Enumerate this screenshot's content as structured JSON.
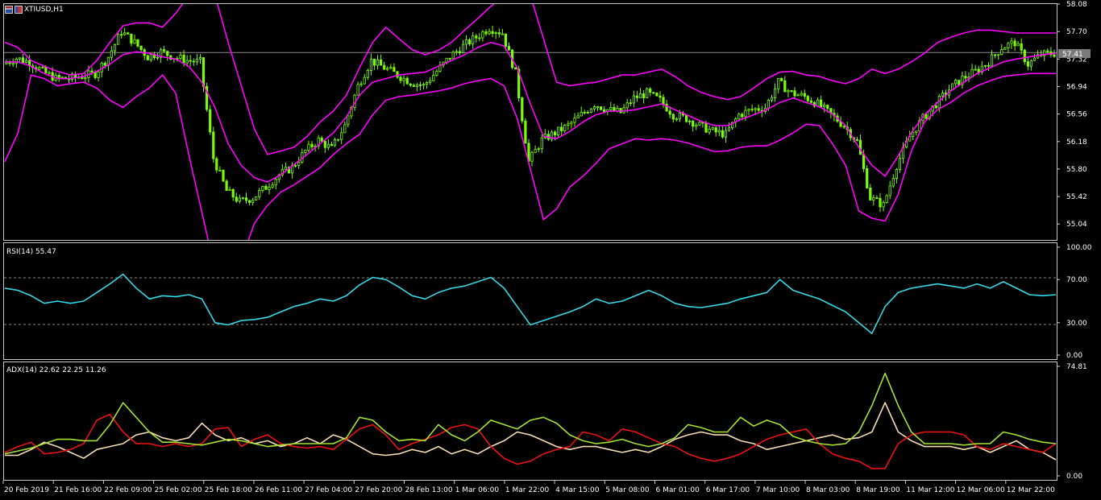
{
  "symbol": {
    "title": "XTIUSD,H1",
    "flag_icon_a": "flag-icon",
    "flag_icon_b": "flag-icon"
  },
  "price_tag": "57.41",
  "colors": {
    "candle": "#7CFC00",
    "bands": "#FF00FF",
    "rsi": "#34D8E6",
    "adx": "#A6E22E",
    "plus_di": "#EE1111",
    "minus_di": "#F5DEB3",
    "frame": "#C8C8C8",
    "grid": "#888888"
  },
  "chart_data": [
    {
      "type": "line",
      "name": "price",
      "title": "XTIUSD,H1",
      "ylim": [
        54.82,
        58.08
      ],
      "y_ticks": [
        "58.08",
        "57.70",
        "57.32",
        "56.94",
        "56.56",
        "56.18",
        "55.80",
        "55.42",
        "55.04"
      ],
      "current_price": 57.41,
      "series": [
        {
          "name": "close",
          "values": [
            57.25,
            57.33,
            57.28,
            57.15,
            57.05,
            57.05,
            57.08,
            57.12,
            57.35,
            57.7,
            57.55,
            57.35,
            57.42,
            57.35,
            57.3,
            57.28,
            55.95,
            55.5,
            55.35,
            55.4,
            55.55,
            55.72,
            55.82,
            56.05,
            56.2,
            56.08,
            56.4,
            56.95,
            57.3,
            57.2,
            57.1,
            57.0,
            56.95,
            57.15,
            57.35,
            57.5,
            57.62,
            57.75,
            57.68,
            57.12,
            55.9,
            56.2,
            56.3,
            56.4,
            56.55,
            56.7,
            56.62,
            56.58,
            56.78,
            56.85,
            56.75,
            56.55,
            56.5,
            56.4,
            56.32,
            56.28,
            56.55,
            56.62,
            56.65,
            57.0,
            56.85,
            56.8,
            56.7,
            56.55,
            56.4,
            56.18,
            55.4,
            55.3,
            55.85,
            56.25,
            56.5,
            56.7,
            56.9,
            57.05,
            57.15,
            57.28,
            57.48,
            57.55,
            57.25,
            57.38,
            57.4
          ]
        },
        {
          "name": "upper_band",
          "values": [
            57.55,
            57.48,
            57.3,
            57.22,
            57.15,
            57.1,
            57.12,
            57.3,
            57.55,
            57.78,
            57.82,
            57.82,
            57.76,
            57.95,
            58.2,
            58.2,
            58.2,
            57.55,
            56.95,
            56.35,
            56.0,
            56.05,
            56.1,
            56.25,
            56.45,
            56.6,
            56.82,
            57.2,
            57.55,
            57.76,
            57.6,
            57.45,
            57.38,
            57.44,
            57.55,
            57.72,
            57.88,
            58.05,
            58.2,
            58.2,
            58.2,
            57.6,
            57.0,
            56.95,
            56.98,
            57.0,
            57.05,
            57.1,
            57.1,
            57.14,
            57.18,
            57.08,
            56.95,
            56.86,
            56.8,
            56.76,
            56.8,
            56.92,
            57.05,
            57.14,
            57.15,
            57.1,
            57.08,
            57.02,
            56.98,
            57.05,
            57.18,
            57.12,
            57.18,
            57.28,
            57.4,
            57.55,
            57.62,
            57.68,
            57.72,
            57.72,
            57.7,
            57.68,
            57.68,
            57.68,
            57.68
          ]
        },
        {
          "name": "middle_band",
          "values": [
            57.28,
            57.28,
            57.22,
            57.12,
            57.05,
            57.05,
            57.08,
            57.15,
            57.25,
            57.38,
            57.42,
            57.4,
            57.35,
            57.32,
            57.22,
            57.0,
            56.65,
            56.15,
            55.85,
            55.68,
            55.62,
            55.72,
            55.86,
            56.0,
            56.15,
            56.3,
            56.52,
            56.82,
            57.0,
            57.05,
            57.1,
            57.12,
            57.14,
            57.22,
            57.3,
            57.38,
            57.48,
            57.55,
            57.5,
            57.2,
            56.7,
            56.25,
            56.22,
            56.32,
            56.45,
            56.55,
            56.6,
            56.6,
            56.62,
            56.66,
            56.7,
            56.62,
            56.54,
            56.46,
            56.4,
            56.4,
            56.48,
            56.55,
            56.62,
            56.72,
            56.78,
            56.72,
            56.66,
            56.56,
            56.4,
            56.1,
            55.85,
            55.7,
            55.98,
            56.3,
            56.55,
            56.72,
            56.88,
            57.0,
            57.12,
            57.2,
            57.28,
            57.32,
            57.35,
            57.38,
            57.4
          ]
        },
        {
          "name": "lower_band",
          "values": [
            55.9,
            56.3,
            57.1,
            57.05,
            56.95,
            56.98,
            57.0,
            56.92,
            56.75,
            56.65,
            56.8,
            56.92,
            57.1,
            56.85,
            56.0,
            55.2,
            54.4,
            54.2,
            54.55,
            55.05,
            55.3,
            55.48,
            55.58,
            55.7,
            55.82,
            56.0,
            56.15,
            56.28,
            56.55,
            56.75,
            56.8,
            56.82,
            56.85,
            56.88,
            56.92,
            56.98,
            57.02,
            57.05,
            56.95,
            56.5,
            55.8,
            55.1,
            55.25,
            55.55,
            55.7,
            55.88,
            56.08,
            56.15,
            56.22,
            56.2,
            56.22,
            56.2,
            56.16,
            56.1,
            56.04,
            56.05,
            56.1,
            56.12,
            56.12,
            56.2,
            56.3,
            56.42,
            56.4,
            56.15,
            55.85,
            55.22,
            55.12,
            55.08,
            55.45,
            56.05,
            56.45,
            56.62,
            56.72,
            56.85,
            56.95,
            57.02,
            57.08,
            57.1,
            57.12,
            57.12,
            57.12
          ]
        }
      ]
    },
    {
      "type": "line",
      "name": "rsi",
      "title": "RSI(14) 55.47",
      "ylim": [
        0,
        100
      ],
      "y_ticks": [
        "100.00",
        "70.00",
        "30.00",
        "0.00"
      ],
      "levels": [
        70,
        30
      ],
      "series": [
        {
          "name": "RSI",
          "values": [
            62,
            60,
            55,
            48,
            50,
            48,
            50,
            58,
            66,
            75,
            62,
            52,
            55,
            54,
            56,
            52,
            30,
            28,
            32,
            33,
            35,
            40,
            45,
            48,
            52,
            50,
            55,
            65,
            72,
            70,
            63,
            55,
            52,
            58,
            62,
            64,
            68,
            72,
            62,
            45,
            28,
            32,
            36,
            40,
            45,
            52,
            48,
            50,
            55,
            60,
            55,
            48,
            45,
            44,
            46,
            48,
            52,
            55,
            58,
            70,
            60,
            56,
            52,
            46,
            40,
            30,
            20,
            45,
            58,
            62,
            64,
            66,
            64,
            62,
            66,
            62,
            68,
            62,
            56,
            55,
            56
          ]
        }
      ]
    },
    {
      "type": "line",
      "name": "adx",
      "title": "ADX(14) 22.62 22.25 11.26",
      "ylim": [
        0,
        74.81
      ],
      "y_ticks": [
        "74.81",
        "0.00"
      ],
      "series": [
        {
          "name": "ADX",
          "values": [
            15,
            17,
            19,
            22,
            25,
            25,
            24,
            24,
            35,
            50,
            40,
            30,
            23,
            23,
            22,
            21,
            23,
            25,
            24,
            22,
            20,
            21,
            22,
            22,
            22,
            22,
            26,
            40,
            38,
            30,
            24,
            25,
            24,
            35,
            28,
            24,
            30,
            38,
            35,
            32,
            38,
            40,
            36,
            28,
            24,
            22,
            23,
            25,
            22,
            20,
            22,
            26,
            35,
            33,
            30,
            30,
            40,
            34,
            38,
            35,
            27,
            24,
            22,
            21,
            22,
            30,
            48,
            70,
            48,
            30,
            22,
            22,
            22,
            21,
            22,
            22,
            30,
            28,
            25,
            23,
            22
          ]
        },
        {
          "name": "+DI",
          "values": [
            16,
            20,
            23,
            15,
            16,
            18,
            22,
            38,
            42,
            30,
            22,
            22,
            20,
            22,
            20,
            22,
            32,
            33,
            20,
            25,
            28,
            22,
            20,
            19,
            20,
            18,
            25,
            32,
            35,
            28,
            18,
            22,
            25,
            28,
            33,
            35,
            32,
            20,
            12,
            8,
            10,
            15,
            18,
            20,
            30,
            28,
            24,
            32,
            30,
            26,
            22,
            20,
            15,
            12,
            10,
            12,
            15,
            20,
            25,
            28,
            30,
            32,
            22,
            15,
            12,
            10,
            5,
            5,
            22,
            28,
            30,
            30,
            30,
            28,
            20,
            18,
            22,
            20,
            18,
            16,
            22
          ]
        },
        {
          "name": "-DI",
          "values": [
            14,
            14,
            18,
            23,
            20,
            16,
            12,
            18,
            20,
            22,
            28,
            30,
            26,
            24,
            26,
            36,
            28,
            24,
            26,
            22,
            24,
            20,
            22,
            26,
            22,
            28,
            25,
            20,
            15,
            14,
            15,
            18,
            16,
            20,
            15,
            18,
            15,
            20,
            24,
            30,
            28,
            24,
            20,
            18,
            20,
            20,
            18,
            16,
            18,
            16,
            20,
            25,
            28,
            30,
            28,
            28,
            24,
            22,
            18,
            20,
            22,
            24,
            26,
            28,
            25,
            26,
            30,
            50,
            30,
            24,
            20,
            20,
            20,
            18,
            20,
            16,
            20,
            24,
            18,
            16,
            11
          ]
        }
      ]
    }
  ],
  "time_axis": [
    "20 Feb 2019",
    "21 Feb 16:00",
    "22 Feb 09:00",
    "25 Feb 02:00",
    "25 Feb 18:00",
    "26 Feb 11:00",
    "27 Feb 04:00",
    "27 Feb 20:00",
    "28 Feb 13:00",
    "1 Mar 06:00",
    "1 Mar 22:00",
    "4 Mar 15:00",
    "5 Mar 08:00",
    "6 Mar 01:00",
    "6 Mar 17:00",
    "7 Mar 10:00",
    "8 Mar 03:00",
    "8 Mar 19:00",
    "11 Mar 12:00",
    "12 Mar 06:00",
    "12 Mar 22:00"
  ]
}
